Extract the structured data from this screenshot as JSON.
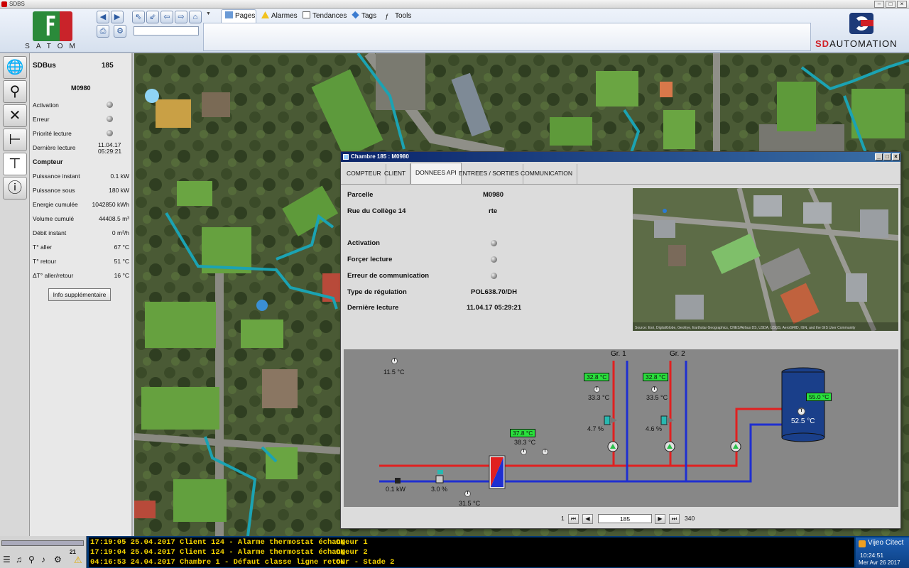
{
  "titlebar": {
    "app_name": "SDBS"
  },
  "brand": {
    "left_name": "SATOM",
    "right_name_a": "SD",
    "right_name_b": "AUTOMATION"
  },
  "ribbon": {
    "tabs": [
      {
        "label": "Pages",
        "icon": "pages-icon"
      },
      {
        "label": "Alarmes",
        "icon": "warning-icon"
      },
      {
        "label": "Tendances",
        "icon": "trend-icon"
      },
      {
        "label": "Tags",
        "icon": "tag-icon"
      },
      {
        "label": "Tools",
        "icon": "tools-icon"
      }
    ]
  },
  "leftbar": {
    "icons": [
      "globe-icon",
      "search-icon",
      "tools-icon",
      "valve-icon",
      "tap-icon",
      "info-icon"
    ]
  },
  "info": {
    "bus_label": "SDBus",
    "bus_value": "185",
    "device": "M0980",
    "rows": [
      {
        "label": "Activation"
      },
      {
        "label": "Erreur"
      },
      {
        "label": "Priorité lecture"
      }
    ],
    "last_read_label": "Dernière lecture",
    "last_read_date": "11.04.17",
    "last_read_time": "05:29:21",
    "counter_title": "Compteur",
    "measures": [
      {
        "label": "Puissance instant",
        "value": "0.1 kW"
      },
      {
        "label": "Puissance sous",
        "value": "180 kW"
      },
      {
        "label": "Energie cumulée",
        "value": "1042850 kWh"
      },
      {
        "label": "Volume cumulé",
        "value": "44408.5 m³"
      },
      {
        "label": "Débit instant",
        "value": "0 m³/h"
      },
      {
        "label": "T° aller",
        "value": "67 °C"
      },
      {
        "label": "T° retour",
        "value": "51 °C"
      },
      {
        "label": "ΔT° aller/retour",
        "value": "16 °C"
      }
    ],
    "button": "Info supplémentaire"
  },
  "dialog": {
    "title": "Chambre 185 : M0980",
    "tabs": [
      "COMPTEUR",
      "CLIENT",
      "DONNEES API",
      "ENTREES / SORTIES",
      "COMMUNICATION"
    ],
    "fields": {
      "parcelle_label": "Parcelle",
      "parcelle_value": "M0980",
      "rue_label": "Rue du Collège 14",
      "rue_value": "rte",
      "activation_label": "Activation",
      "forcer_label": "Forçer lecture",
      "erreur_label": "Erreur de communication",
      "regulation_label": "Type de régulation",
      "regulation_value": "POL638.70/DH",
      "last_label": "Dernière lecture",
      "last_value": "11.04.17 05:29:21"
    },
    "photo_caption": "Source: Esri, DigitalGlobe, GeoEye, Earthstar Geographics, CNES/Airbus DS, USDA, USGS, AeroGRID, IGN, and the GIS User Community",
    "schema": {
      "outside_temp": "11.5 °C",
      "gr1_label": "Gr. 1",
      "gr2_label": "Gr. 2",
      "gr1_set": "32.8 °C",
      "gr1_temp": "33.3 °C",
      "gr1_valve": "4.7 %",
      "gr2_set": "32.8 °C",
      "gr2_temp": "33.5 °C",
      "gr2_valve": "4.6 %",
      "hx_set": "37.8 °C",
      "hx_temp": "38.3 °C",
      "power": "0.1 kW",
      "main_valve": "3.0 %",
      "return_temp": "31.5 °C",
      "tank_set": "55.0 °C",
      "tank_temp": "52.5 °C"
    },
    "pager": {
      "first": "1",
      "current": "185",
      "last": "340"
    }
  },
  "alarms": [
    {
      "text": "17:19:05 25.04.2017 Client 124 - Alarme thermostat échangeur 1",
      "state": "ON"
    },
    {
      "text": "17:19:04 25.04.2017 Client 124 - Alarme thermostat échangeur 2",
      "state": "ON"
    },
    {
      "text": "04:16:53 24.04.2017 Chambre 1 - Défaut classe ligne retour - Stade 2",
      "state": "ON"
    }
  ],
  "taskbar": {
    "badge": "21"
  },
  "tray": {
    "product": "Vijeo Citect",
    "time": "10:24:51",
    "date": "Mer Avr 26 2017"
  }
}
